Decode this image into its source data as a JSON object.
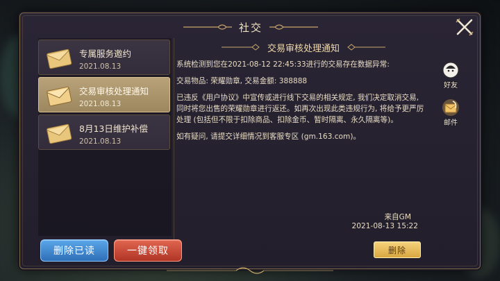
{
  "window": {
    "title": "社交"
  },
  "mails": [
    {
      "title": "专属服务邀约",
      "date": "2021.08.13",
      "selected": false
    },
    {
      "title": "交易审核处理通知",
      "date": "2021.08.13",
      "selected": true
    },
    {
      "title": "8月13日维护补偿",
      "date": "2021.08.13",
      "selected": false
    }
  ],
  "detail": {
    "title": "交易审核处理通知",
    "paragraphs": [
      "系统检测到您在2021-08-12  22:45:33进行的交易存在数据异常:",
      "交易物品: 荣耀勋章, 交易金额: 388888",
      "已违反《用户协议》中宣传或进行线下交易的相关规定, 我们决定取消交易, 同时将您出售的荣耀勋章进行返还。如再次出现此类违规行为, 将给予更严厉处理 (包括但不限于扣除商品、扣除金币、暂时隔离、永久隔离等)。",
      "如有疑问, 请提交详细情况到客服专区 (gm.163.com)。"
    ],
    "sender": "来自GM",
    "time": "2021-08-13  15:22"
  },
  "buttons": {
    "delete_read": "删除已读",
    "claim_all": "一键领取",
    "delete": "删除"
  },
  "side_tabs": [
    {
      "label": "好友",
      "icon": "friend-avatar-icon"
    },
    {
      "label": "邮件",
      "icon": "mail-feather-icon"
    }
  ],
  "colors": {
    "accent_gold": "#d9a640",
    "selected_item": "#b9a27a",
    "button_blue": "#2f6fb8",
    "button_red": "#b03526"
  }
}
